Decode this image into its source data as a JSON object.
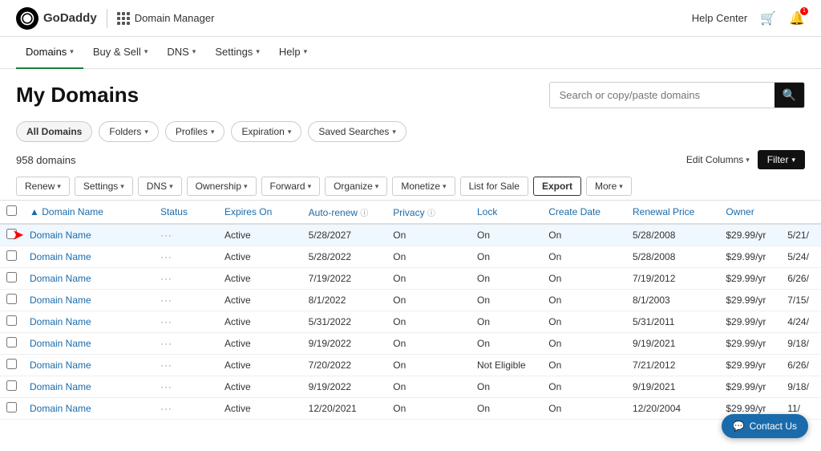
{
  "topbar": {
    "logo_text": "GoDaddy",
    "separator": "|",
    "app_name": "Domain Manager",
    "help_center": "Help Center"
  },
  "nav": {
    "items": [
      {
        "label": "Domains",
        "active": true
      },
      {
        "label": "Buy & Sell",
        "active": false
      },
      {
        "label": "DNS",
        "active": false
      },
      {
        "label": "Settings",
        "active": false
      },
      {
        "label": "Help",
        "active": false
      }
    ]
  },
  "page": {
    "title": "My Domains",
    "search_placeholder": "Search or copy/paste domains"
  },
  "filters": {
    "items": [
      {
        "label": "All Domains",
        "active": true
      },
      {
        "label": "Folders"
      },
      {
        "label": "Profiles"
      },
      {
        "label": "Expiration"
      },
      {
        "label": "Saved Searches"
      }
    ]
  },
  "domain_count": "958 domains",
  "edit_columns": "Edit Columns",
  "filter_label": "Filter",
  "action_buttons": [
    {
      "label": "Renew"
    },
    {
      "label": "Settings"
    },
    {
      "label": "DNS"
    },
    {
      "label": "Ownership"
    },
    {
      "label": "Forward"
    },
    {
      "label": "Organize"
    },
    {
      "label": "Monetize"
    },
    {
      "label": "List for Sale"
    },
    {
      "label": "Export",
      "bold": true
    },
    {
      "label": "More"
    }
  ],
  "table": {
    "columns": [
      {
        "label": "Domain Name",
        "sort": true
      },
      {
        "label": "Status"
      },
      {
        "label": "Expires On"
      },
      {
        "label": "Auto-renew",
        "info": true
      },
      {
        "label": "Privacy",
        "info": true
      },
      {
        "label": "Lock"
      },
      {
        "label": "Create Date"
      },
      {
        "label": "Renewal Price"
      },
      {
        "label": "Owner"
      }
    ],
    "rows": [
      {
        "domain": "Domain Name",
        "status": "Active",
        "expires": "5/28/2027",
        "autorenew": "On",
        "privacy": "On",
        "lock": "On",
        "create": "5/28/2008",
        "price": "$29.99/yr",
        "owner": "5/21/",
        "highlight": true
      },
      {
        "domain": "Domain Name",
        "status": "Active",
        "expires": "5/28/2022",
        "autorenew": "On",
        "privacy": "On",
        "lock": "On",
        "create": "5/28/2008",
        "price": "$29.99/yr",
        "owner": "5/24/"
      },
      {
        "domain": "Domain Name",
        "status": "Active",
        "expires": "7/19/2022",
        "autorenew": "On",
        "privacy": "On",
        "lock": "On",
        "create": "7/19/2012",
        "price": "$29.99/yr",
        "owner": "6/26/"
      },
      {
        "domain": "Domain Name",
        "status": "Active",
        "expires": "8/1/2022",
        "autorenew": "On",
        "privacy": "On",
        "lock": "On",
        "create": "8/1/2003",
        "price": "$29.99/yr",
        "owner": "7/15/"
      },
      {
        "domain": "Domain Name",
        "status": "Active",
        "expires": "5/31/2022",
        "autorenew": "On",
        "privacy": "On",
        "lock": "On",
        "create": "5/31/2011",
        "price": "$29.99/yr",
        "owner": "4/24/"
      },
      {
        "domain": "Domain Name",
        "status": "Active",
        "expires": "9/19/2022",
        "autorenew": "On",
        "privacy": "On",
        "lock": "On",
        "create": "9/19/2021",
        "price": "$29.99/yr",
        "owner": "9/18/"
      },
      {
        "domain": "Domain Name",
        "status": "Active",
        "expires": "7/20/2022",
        "autorenew": "On",
        "privacy": "Not Eligible",
        "lock": "On",
        "create": "7/21/2012",
        "price": "$29.99/yr",
        "owner": "6/26/"
      },
      {
        "domain": "Domain Name",
        "status": "Active",
        "expires": "9/19/2022",
        "autorenew": "On",
        "privacy": "On",
        "lock": "On",
        "create": "9/19/2021",
        "price": "$29.99/yr",
        "owner": "9/18/"
      },
      {
        "domain": "Domain Name",
        "status": "Active",
        "expires": "12/20/2021",
        "autorenew": "On",
        "privacy": "On",
        "lock": "On",
        "create": "12/20/2004",
        "price": "$29.99/yr",
        "owner": "11/"
      }
    ]
  },
  "contact_us": "Contact Us"
}
